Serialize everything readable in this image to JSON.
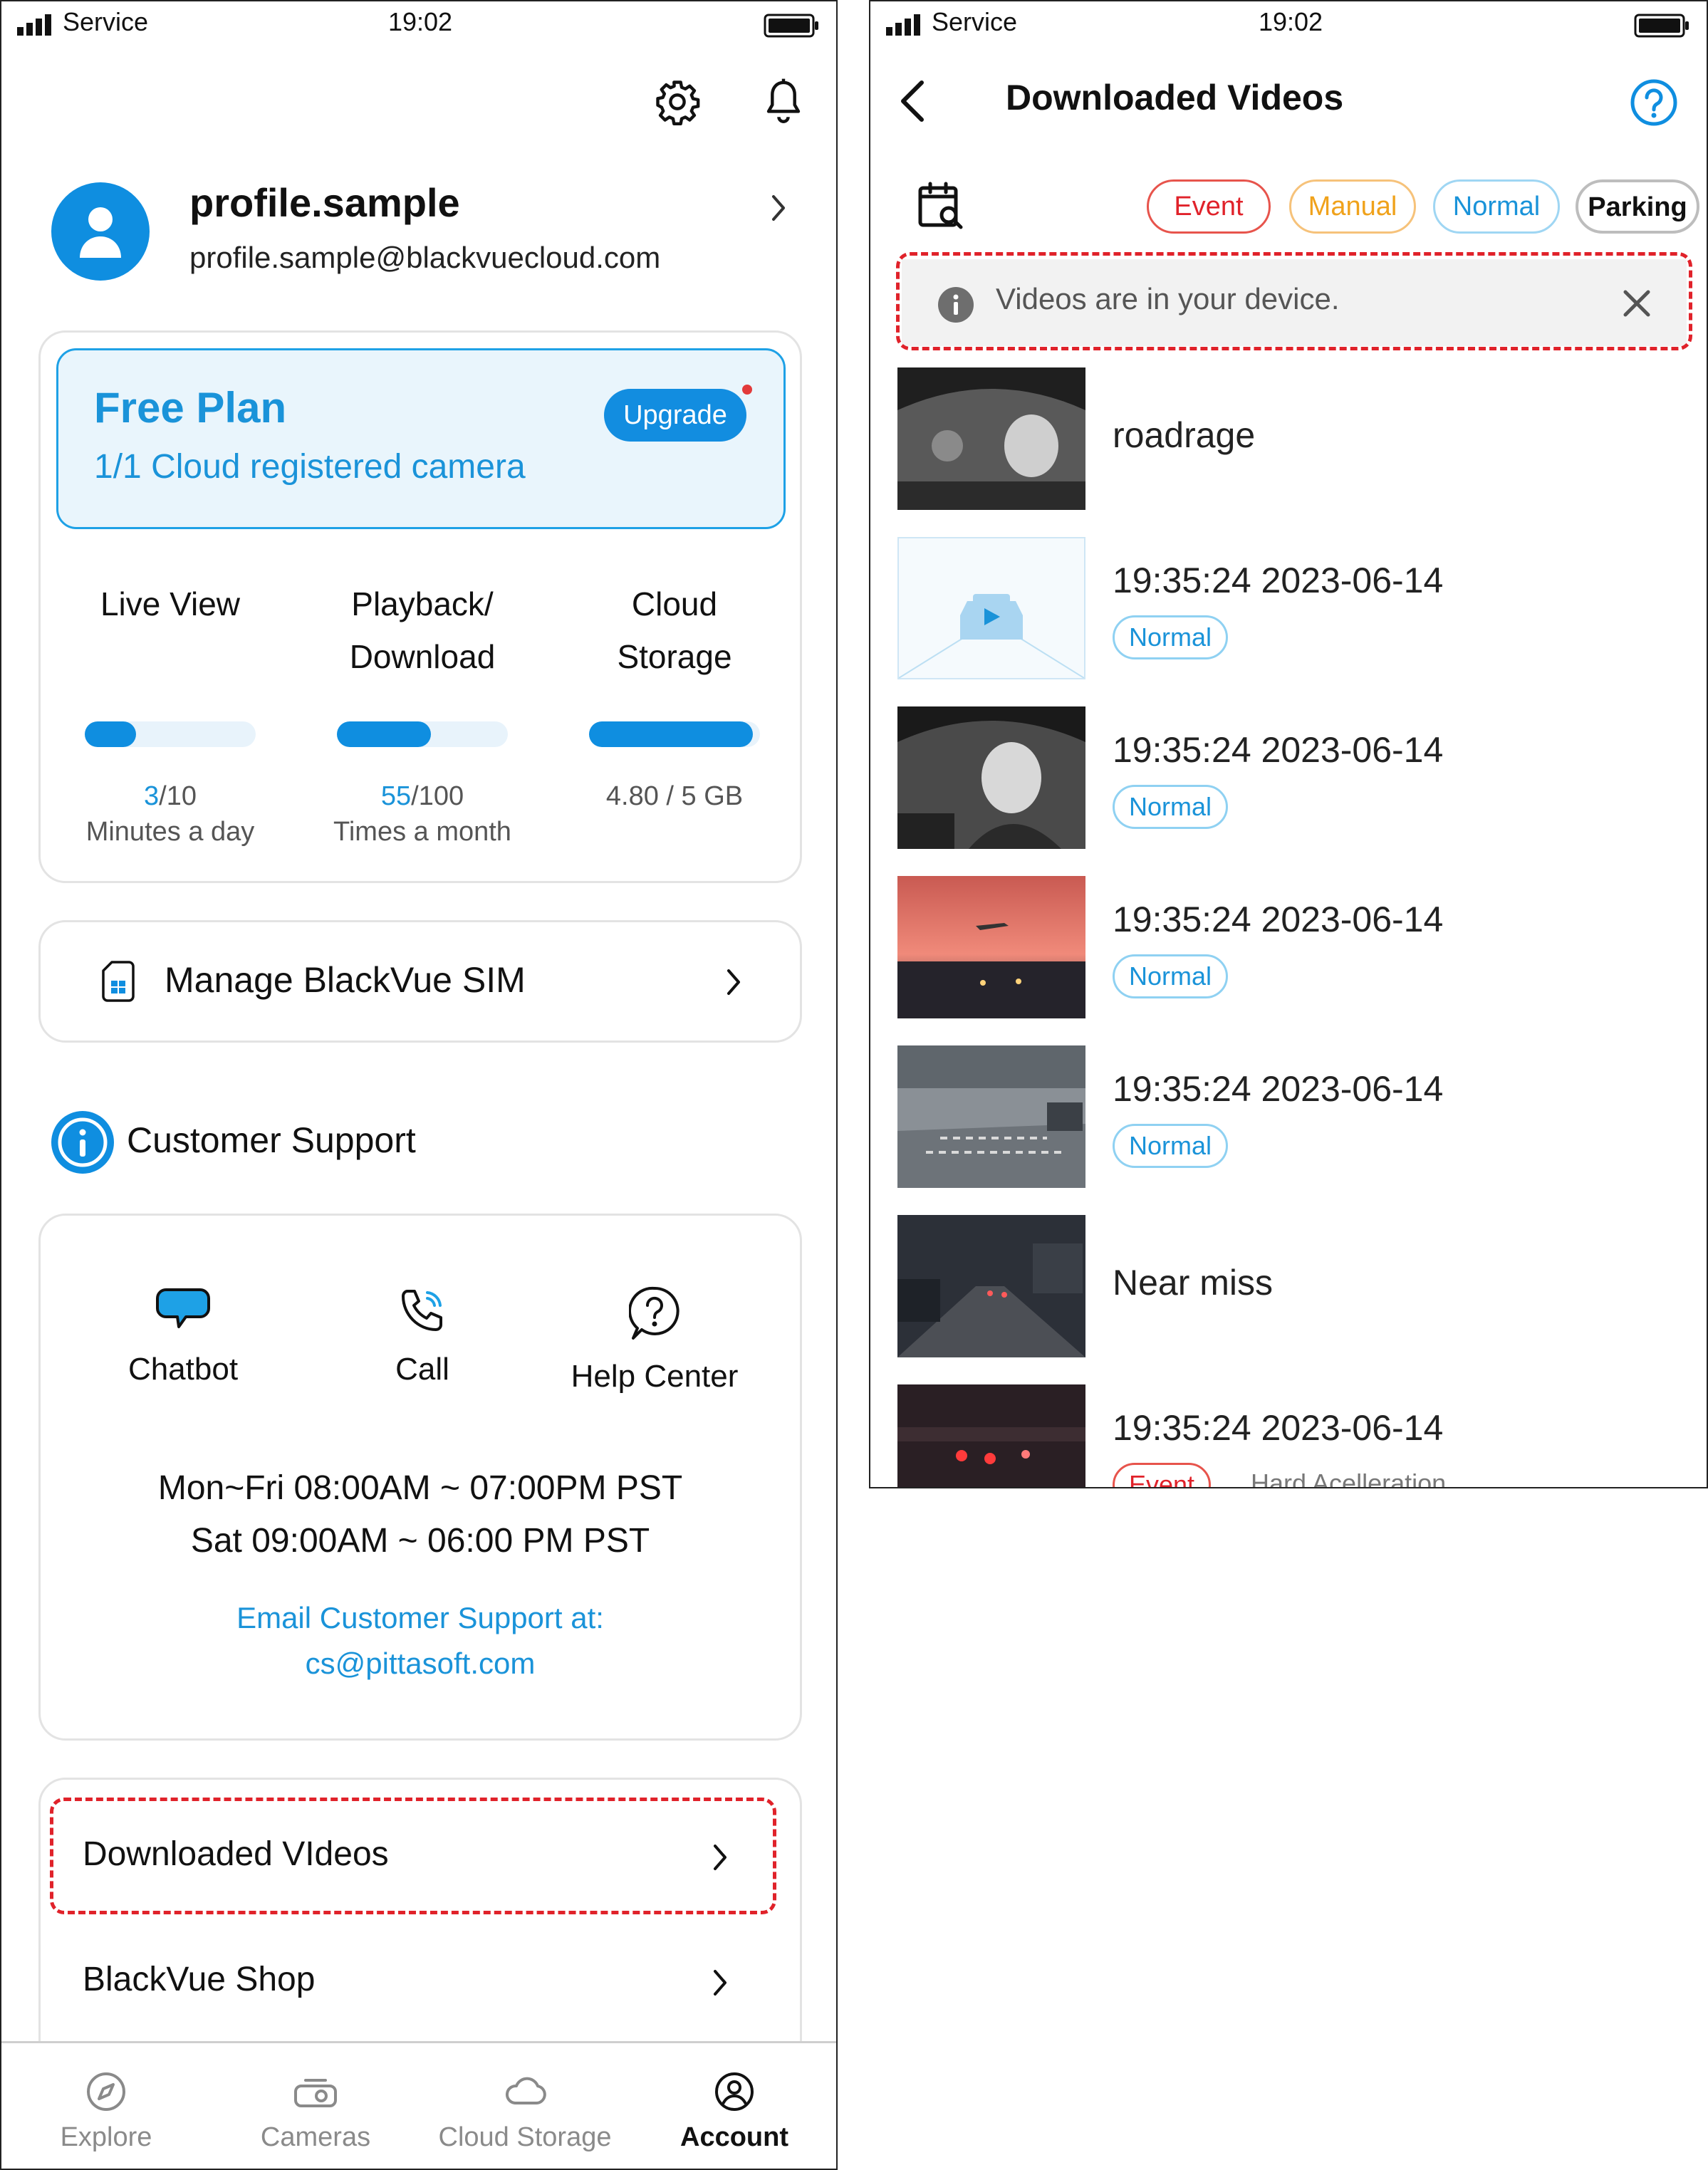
{
  "status_bar": {
    "carrier": "Service",
    "time": "19:02"
  },
  "account": {
    "profile": {
      "name": "profile.sample",
      "email": "profile.sample@blackvuecloud.com"
    },
    "plan": {
      "title": "Free Plan",
      "subtitle": "1/1 Cloud registered camera",
      "upgrade_label": "Upgrade"
    },
    "usage": [
      {
        "label_line1": "Live View",
        "label_line2": "",
        "used": "3",
        "total": "/10",
        "unit": "Minutes a day",
        "fraction": 0.3
      },
      {
        "label_line1": "Playback/",
        "label_line2": "Download",
        "used": "55",
        "total": "/100",
        "unit": "Times a month",
        "fraction": 0.55
      },
      {
        "label_line1": "Cloud",
        "label_line2": "Storage",
        "used": "",
        "total": "4.80 / 5 GB",
        "unit": "",
        "fraction": 0.96
      }
    ],
    "sim_label": "Manage BlackVue SIM",
    "support_title": "Customer Support",
    "support_items": [
      "Chatbot",
      "Call",
      "Help Center"
    ],
    "hours": [
      "Mon~Fri 08:00AM ~ 07:00PM PST",
      "Sat 09:00AM ~ 06:00  PM PST"
    ],
    "email_line1": "Email Customer Support at:",
    "email_line2": "cs@pittasoft.com",
    "menu": [
      "Downloaded VIdeos",
      "BlackVue Shop"
    ],
    "tabs": [
      "Explore",
      "Cameras",
      "Cloud Storage",
      "Account"
    ],
    "active_tab": "Account"
  },
  "downloaded": {
    "title": "Downloaded Videos",
    "filters": [
      "Event",
      "Manual",
      "Normal",
      "Parking"
    ],
    "notice": "Videos are in your device.",
    "videos": [
      {
        "title": "roadrage",
        "badge": "",
        "extra": ""
      },
      {
        "title": "19:35:24  2023-06-14",
        "badge": "Normal",
        "extra": ""
      },
      {
        "title": "19:35:24  2023-06-14",
        "badge": "Normal",
        "extra": ""
      },
      {
        "title": "19:35:24  2023-06-14",
        "badge": "Normal",
        "extra": ""
      },
      {
        "title": "19:35:24  2023-06-14",
        "badge": "Normal",
        "extra": ""
      },
      {
        "title": "Near miss",
        "badge": "",
        "extra": ""
      },
      {
        "title": "19:35:24  2023-06-14",
        "badge": "Event",
        "extra": "Hard Acelleration"
      }
    ]
  },
  "colors": {
    "accent": "#0f8ee0",
    "accent_light": "#e9f5fc",
    "event": "#e0222a",
    "manual": "#f0a21b",
    "normal": "#1a93d9",
    "highlight_dash": "#e0222a"
  }
}
